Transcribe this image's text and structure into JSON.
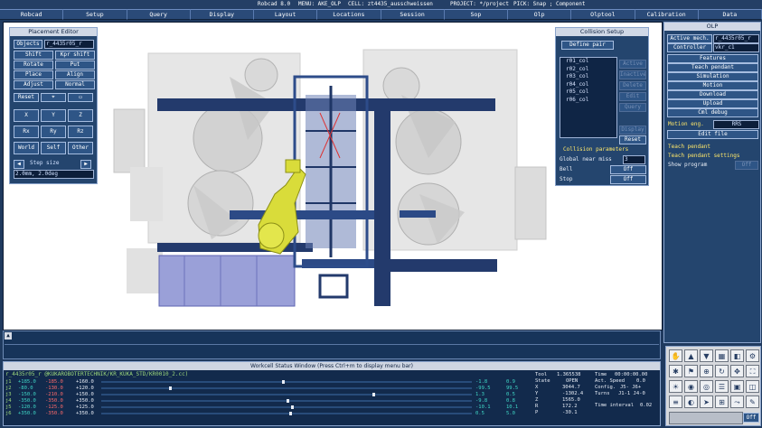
{
  "titlebar": {
    "app": "Robcad 8.0",
    "menu": "MENU: AKE_OLP",
    "cell": "CELL: zt4435_ausschweissen",
    "project": "PROJECT: */project",
    "pick": "PICK: Snap ; Component"
  },
  "menubar": [
    "Robcad",
    "Setup",
    "Query",
    "Display",
    "Layout",
    "Locations",
    "Session",
    "Sop",
    "Olp",
    "Olptool",
    "Calibration",
    "Data"
  ],
  "placement_editor": {
    "title": "Placement Editor",
    "objects_label": "Objects",
    "objects_value": "r_4435r05_r",
    "ops": [
      "Shift",
      "Kpr shift",
      "Rotate",
      "Put",
      "Place",
      "Align",
      "Adjust",
      "Normal"
    ],
    "reset": "Reset",
    "axes": [
      "X",
      "Y",
      "Z",
      "Rx",
      "Ry",
      "Rz"
    ],
    "frames": [
      "World",
      "Self",
      "Other"
    ],
    "step_size_label": "Step size",
    "step_value": "2.0mm, 2.0deg"
  },
  "collision_setup": {
    "title": "Collision Setup",
    "define_pair": "Define pair",
    "pairs": [
      "r01_col",
      "r02_col",
      "r03_col",
      "r04_col",
      "r05_col",
      "r06_col"
    ],
    "actions": [
      "Active",
      "Inactive",
      "Delete",
      "Edit",
      "Query"
    ],
    "display": "Display",
    "reset": "Reset",
    "params_title": "Collision parameters",
    "global_near_miss_label": "Global near miss",
    "global_near_miss_value": "3",
    "bell_label": "Bell",
    "bell_value": "Off",
    "stop_label": "Stop",
    "stop_value": "Off"
  },
  "olp": {
    "title": "OLP",
    "active_mech_label": "Active mech.",
    "active_mech_value": "r_4435r05_r",
    "controller_label": "Controller",
    "controller_value": "vkr_c1",
    "buttons": [
      "Features",
      "Teach pendant",
      "Simulation",
      "Motion",
      "Download",
      "Upload",
      "Cml debug"
    ],
    "motion_eng_label": "Motion eng.",
    "motion_eng_value": "RRS",
    "edit_file": "Edit file",
    "teach_pendant": "Teach pendant",
    "teach_pendant_settings": "Teach pendant settings",
    "show_program_label": "Show program",
    "show_program_value": "Off"
  },
  "status_window": {
    "title": "Workcell Status Window  (Press Ctrl+m to display menu bar)",
    "path": "r_4435r05_r @KUKAROBOTERTECHNIK/KR_KUKA_STD/KR0010_2.cc)",
    "joints": [
      {
        "name": "j1",
        "a": "+185.0",
        "b": "-185.0",
        "c": "+160.0",
        "d": "160.0"
      },
      {
        "name": "j2",
        "a": "-80.0",
        "b": "-130.0",
        "c": "+120.0",
        "d": "120.0"
      },
      {
        "name": "j3",
        "a": "-150.0",
        "b": "-210.0",
        "c": "+150.0",
        "d": "150.0"
      },
      {
        "name": "j4",
        "a": "-350.0",
        "b": "-350.0",
        "c": "+350.0",
        "d": "350.0"
      },
      {
        "name": "j5",
        "a": "-120.0",
        "b": "-125.0",
        "c": "+125.0",
        "d": "125.0"
      },
      {
        "name": "j6",
        "a": "+350.0",
        "b": "-350.0",
        "c": "+350.0",
        "d": "350.0"
      }
    ],
    "right_vals": [
      [
        "-1.8",
        "0.9"
      ],
      [
        "-99.5",
        "99.5"
      ],
      [
        "1.3",
        "0.5"
      ],
      [
        "-9.8",
        "0.8"
      ],
      [
        "-10.1",
        "10.1"
      ],
      [
        "0.5",
        "5.0"
      ]
    ],
    "tool": {
      "label": "Tool",
      "value": "1.365538"
    },
    "state": {
      "label": "State",
      "value": "OPEN"
    },
    "xyz": [
      [
        "X",
        "3044.7"
      ],
      [
        "Y",
        "-1302.4"
      ],
      [
        "Z",
        "1565.0"
      ],
      [
        "R",
        "172.2"
      ],
      [
        "P",
        "-30.1"
      ]
    ],
    "time": {
      "label": "Time",
      "value": "00:00:00.00"
    },
    "act_speed": {
      "label": "Act. Speed",
      "value": "0.0"
    },
    "config": {
      "label": "Config.",
      "value": "J5-  J6+"
    },
    "turns": {
      "label": "Turns",
      "value": "J1-1  J4-0"
    },
    "time_interval": {
      "label": "Time interval",
      "value": "0.02"
    }
  },
  "icons": [
    "hand-icon",
    "arrow-up-icon",
    "arrow-down-icon",
    "grid-icon",
    "cube-icon",
    "robot-icon",
    "gear-icon",
    "flag-icon",
    "zoom-icon",
    "rotate-icon",
    "pan-icon",
    "fit-icon",
    "light-icon",
    "camera-icon",
    "target-icon",
    "menu-icon",
    "box-icon",
    "split-icon",
    "layers-icon",
    "view-icon"
  ]
}
